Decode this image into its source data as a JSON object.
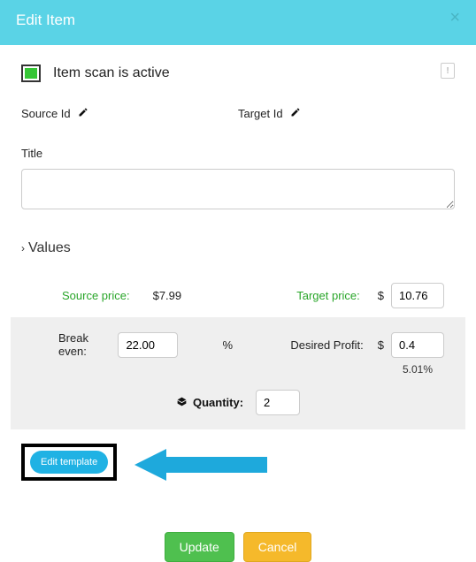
{
  "header": {
    "title": "Edit Item"
  },
  "status": {
    "text": "Item scan is active",
    "info": "!"
  },
  "ids": {
    "source_label": "Source Id",
    "target_label": "Target Id"
  },
  "title_field": {
    "label": "Title",
    "value": ""
  },
  "values_section": {
    "heading": "Values",
    "source_price_label": "Source price:",
    "source_price_value": "$7.99",
    "target_price_label": "Target price:",
    "target_price_currency": "$",
    "target_price_value": "10.76",
    "break_even_label": "Break even:",
    "break_even_value": "22.00",
    "break_even_unit": "%",
    "desired_profit_label": "Desired Profit:",
    "desired_profit_currency": "$",
    "desired_profit_value": "0.4",
    "profit_pct": "5.01%",
    "quantity_label": "Quantity:",
    "quantity_value": "2"
  },
  "actions": {
    "edit_template": "Edit template",
    "update": "Update",
    "cancel": "Cancel"
  }
}
